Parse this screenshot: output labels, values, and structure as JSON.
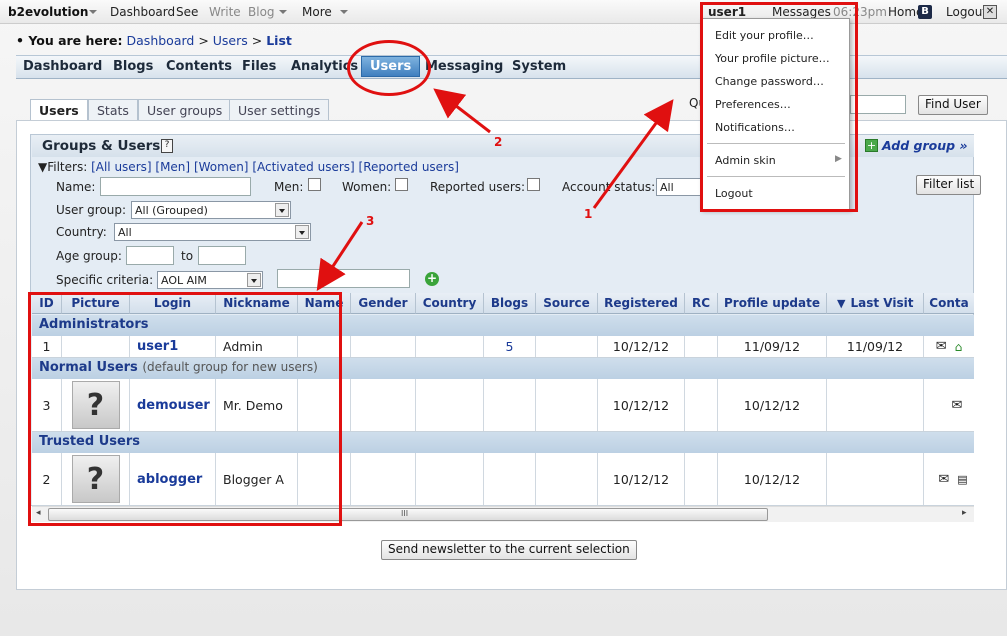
{
  "topbar": {
    "brand": "b2evolution",
    "items": [
      "Dashboard",
      "See",
      "Write",
      "Blog",
      "More"
    ],
    "user": "user1",
    "messages": "Messages",
    "time": "06:23pm",
    "home": "Home",
    "logout": "Logout"
  },
  "breadcrumb": {
    "prefix": "• You are here:",
    "items": [
      "Dashboard",
      "Users"
    ],
    "current": "List"
  },
  "mainnav": [
    "Dashboard",
    "Blogs",
    "Contents",
    "Files",
    "Analytics",
    "Users",
    "Messaging",
    "System"
  ],
  "tabs": [
    "Users",
    "Stats",
    "User groups",
    "User settings"
  ],
  "find": {
    "label": "Qu",
    "button": "Find User"
  },
  "groups": {
    "title": "Groups & Users",
    "add_group": "Add group »",
    "filters_label": "▼Filters:",
    "filter_links": [
      "[All users]",
      "[Men]",
      "[Women]",
      "[Activated users]",
      "[Reported users]"
    ],
    "name_label": "Name:",
    "men_label": "Men:",
    "women_label": "Women:",
    "reported_label": "Reported users:",
    "status_label": "Account status:",
    "status_value": "All",
    "filter_button": "Filter list",
    "usergroup_label": "User group:",
    "usergroup_value": "All (Grouped)",
    "country_label": "Country:",
    "country_value": "All",
    "age_label": "Age group:",
    "age_to": "to",
    "criteria_label": "Specific criteria:",
    "criteria_value": "AOL AIM"
  },
  "table": {
    "headers": [
      "ID",
      "Picture",
      "Login",
      "Nickname",
      "Name",
      "Gender",
      "Country",
      "Blogs",
      "Source",
      "Registered",
      "RC",
      "Profile update",
      "Last Visit",
      "Conta"
    ],
    "groups": [
      {
        "name": "Administrators",
        "note": "",
        "rows": [
          {
            "id": "1",
            "login": "user1",
            "nickname": "Admin",
            "blogs": "5",
            "registered": "10/12/12",
            "profile_update": "11/09/12",
            "last_visit": "11/09/12"
          }
        ]
      },
      {
        "name": "Normal Users",
        "note": "(default group for new users)",
        "rows": [
          {
            "id": "3",
            "login": "demouser",
            "nickname": "Mr. Demo",
            "blogs": "",
            "registered": "10/12/12",
            "profile_update": "10/12/12",
            "last_visit": ""
          }
        ]
      },
      {
        "name": "Trusted Users",
        "note": "",
        "rows": [
          {
            "id": "2",
            "login": "ablogger",
            "nickname": "Blogger A",
            "blogs": "",
            "registered": "10/12/12",
            "profile_update": "10/12/12",
            "last_visit": ""
          }
        ]
      }
    ],
    "scroll_grip": "III"
  },
  "newsletter_button": "Send newsletter to the current selection",
  "usermenu": {
    "items": [
      "Edit your profile…",
      "Your profile picture…",
      "Change password…",
      "Preferences…",
      "Notifications…"
    ],
    "admin_skin": "Admin skin",
    "logout": "Logout"
  },
  "annotations": [
    "1",
    "2",
    "3"
  ],
  "colors": {
    "annotation": "#e01010",
    "active_nav": "#3f7fbf",
    "link": "#1a3b9a"
  }
}
